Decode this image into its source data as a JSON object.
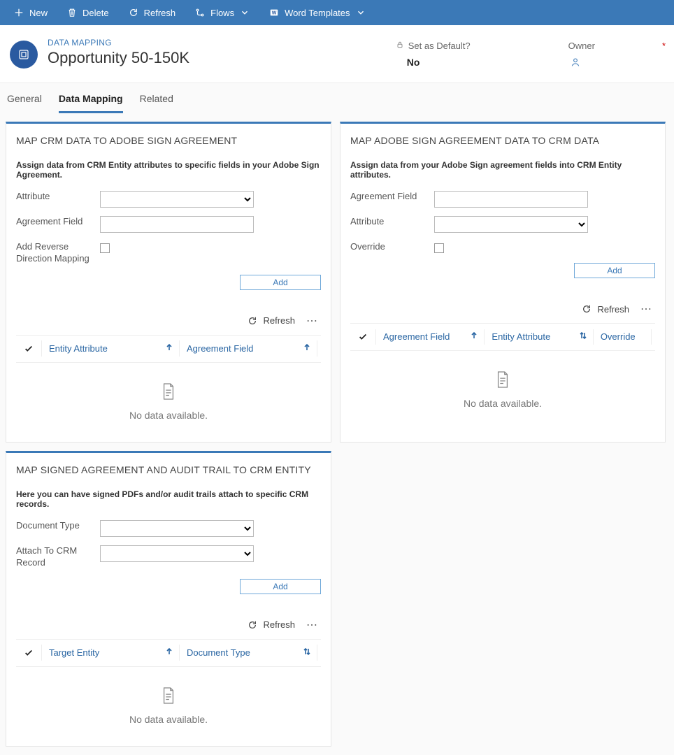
{
  "commandBar": {
    "new": "New",
    "delete": "Delete",
    "refresh": "Refresh",
    "flows": "Flows",
    "wordTemplates": "Word Templates"
  },
  "header": {
    "entityType": "DATA MAPPING",
    "recordName": "Opportunity 50-150K",
    "setAsDefault": {
      "label": "Set as Default?",
      "value": "No"
    },
    "owner": {
      "label": "Owner",
      "required": "*"
    }
  },
  "tabs": {
    "general": "General",
    "dataMapping": "Data Mapping",
    "related": "Related"
  },
  "cards": {
    "crmToSign": {
      "title": "MAP CRM DATA TO ADOBE SIGN AGREEMENT",
      "desc": "Assign data from CRM Entity attributes to specific fields in your Adobe Sign Agreement.",
      "fields": {
        "attribute": "Attribute",
        "agreementField": "Agreement Field",
        "addReverse": "Add Reverse Direction Mapping"
      },
      "addBtn": "Add",
      "toolbar": {
        "refresh": "Refresh"
      },
      "cols": {
        "entityAttribute": "Entity Attribute",
        "agreementField": "Agreement Field"
      },
      "noData": "No data available."
    },
    "signToCrm": {
      "title": "MAP ADOBE SIGN AGREEMENT DATA TO CRM DATA",
      "desc": "Assign data from your Adobe Sign agreement fields into CRM Entity attributes.",
      "fields": {
        "agreementField": "Agreement Field",
        "attribute": "Attribute",
        "override": "Override"
      },
      "addBtn": "Add",
      "toolbar": {
        "refresh": "Refresh"
      },
      "cols": {
        "agreementField": "Agreement Field",
        "entityAttribute": "Entity Attribute",
        "override": "Override"
      },
      "noData": "No data available."
    },
    "attach": {
      "title": "MAP SIGNED AGREEMENT AND AUDIT TRAIL TO CRM ENTITY",
      "desc": "Here you can have signed PDFs and/or audit trails attach to specific CRM records.",
      "fields": {
        "documentType": "Document Type",
        "attachTo": "Attach To CRM Record"
      },
      "addBtn": "Add",
      "toolbar": {
        "refresh": "Refresh"
      },
      "cols": {
        "targetEntity": "Target Entity",
        "documentType": "Document Type"
      },
      "noData": "No data available."
    }
  }
}
